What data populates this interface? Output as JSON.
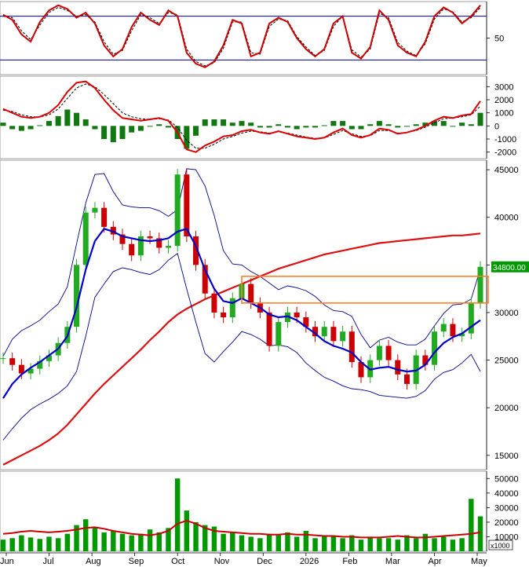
{
  "chart_data": [
    {
      "type": "line",
      "panel": "stochastic",
      "y_ticks": [
        50
      ],
      "ylim": [
        0,
        100
      ],
      "levels": [
        80,
        20
      ],
      "series": [
        {
          "values": [
            82,
            75,
            55,
            45,
            72,
            88,
            95,
            90,
            78,
            85,
            70,
            40,
            25,
            35,
            65,
            85,
            75,
            68,
            88,
            80,
            30,
            15,
            10,
            18,
            40,
            75,
            70,
            25,
            30,
            70,
            78,
            72,
            50,
            35,
            25,
            35,
            70,
            80,
            30,
            22,
            38,
            88,
            75,
            40,
            30,
            25,
            45,
            80,
            92,
            85,
            70,
            80,
            95
          ]
        },
        {
          "values": [
            80,
            78,
            60,
            48,
            68,
            85,
            92,
            88,
            80,
            82,
            72,
            45,
            28,
            33,
            60,
            82,
            78,
            70,
            85,
            82,
            35,
            18,
            12,
            16,
            36,
            72,
            72,
            30,
            28,
            66,
            76,
            74,
            52,
            38,
            26,
            33,
            66,
            80,
            34,
            24,
            35,
            84,
            78,
            44,
            32,
            26,
            42,
            76,
            90,
            86,
            72,
            78,
            92
          ]
        }
      ]
    },
    {
      "type": "line",
      "panel": "macd",
      "y_ticks": [
        3000,
        2000,
        1000,
        0,
        -1000,
        -2000
      ],
      "ylim": [
        -2500,
        3800
      ],
      "series": [
        {
          "values": [
            1300,
            1000,
            700,
            600,
            700,
            1000,
            1600,
            2600,
            3300,
            3400,
            2900,
            2000,
            1200,
            600,
            500,
            400,
            500,
            600,
            400,
            -500,
            -1800,
            -2000,
            -1500,
            -1200,
            -800,
            -700,
            -400,
            -300,
            -500,
            -600,
            -400,
            -600,
            -800,
            -900,
            -1000,
            -900,
            -500,
            -200,
            -700,
            -900,
            -700,
            -200,
            -300,
            -600,
            -500,
            -300,
            0,
            400,
            700,
            600,
            800,
            900,
            1900
          ]
        },
        {
          "values": [
            1200,
            1100,
            850,
            700,
            680,
            850,
            1300,
            2100,
            2900,
            3200,
            3000,
            2400,
            1700,
            1000,
            700,
            550,
            500,
            550,
            450,
            -100,
            -1100,
            -1700,
            -1700,
            -1400,
            -1000,
            -800,
            -550,
            -400,
            -450,
            -550,
            -450,
            -550,
            -700,
            -850,
            -950,
            -920,
            -650,
            -350,
            -600,
            -800,
            -750,
            -350,
            -350,
            -550,
            -500,
            -350,
            -100,
            250,
            550,
            600,
            700,
            850,
            1500
          ]
        }
      ]
    },
    {
      "type": "line",
      "panel": "price",
      "y_ticks": [
        45000,
        40000,
        35000,
        30000,
        25000,
        20000,
        15000
      ],
      "ylim": [
        13500,
        46000
      ],
      "x_ticks": [
        "Jun",
        "Jul",
        "Aug",
        "Sep",
        "Oct",
        "Nov",
        "Dec",
        "2026",
        "Feb",
        "Mar",
        "Apr",
        "May"
      ],
      "last_price_label": "34800.00",
      "series": [
        {
          "values": [
            25200,
            24500,
            23600,
            24100,
            24900,
            25500,
            26800,
            28500,
            35000,
            40500,
            41000,
            39000,
            38200,
            37200,
            36000,
            38000,
            37800,
            36800,
            37000,
            44500,
            38000,
            35000,
            32000,
            30000,
            29500,
            31500,
            33000,
            31000,
            30000,
            26500,
            29000,
            30000,
            29500,
            28500,
            27500,
            28500,
            27000,
            28000,
            24800,
            23200,
            25000,
            26500,
            25000,
            23500,
            22500,
            25500,
            24500,
            28000,
            28800,
            27500,
            27800,
            31000,
            34800
          ]
        },
        {
          "values": [
            21000,
            22500,
            23500,
            24200,
            24800,
            25500,
            26200,
            27500,
            30500,
            34500,
            37500,
            38800,
            38500,
            38000,
            37800,
            37600,
            37500,
            37600,
            37800,
            38500,
            38800,
            37000,
            34500,
            32500,
            31200,
            31000,
            31500,
            31000,
            30500,
            29800,
            29500,
            29600,
            29200,
            28500,
            27800,
            27000,
            26500,
            26200,
            25800,
            24800,
            24000,
            24200,
            24300,
            24000,
            23800,
            23900,
            24500,
            25800,
            26800,
            27400,
            27800,
            28500,
            29200
          ]
        },
        {
          "values": [
            16600,
            17800,
            18900,
            19800,
            20400,
            20900,
            21500,
            22300,
            23800,
            27500,
            31600,
            33000,
            34300,
            34700,
            34500,
            34200,
            34000,
            34500,
            35500,
            36200,
            32500,
            29000,
            25700,
            24800,
            25900,
            26900,
            28000,
            27700,
            27200,
            26500,
            26600,
            26400,
            25800,
            24700,
            23900,
            23200,
            22800,
            22300,
            22000,
            21900,
            21700,
            21300,
            21200,
            21100,
            21000,
            21200,
            21800,
            23000,
            23700,
            24000,
            24700,
            25600,
            23800
          ]
        },
        {
          "values": [
            25400,
            27200,
            28100,
            28600,
            29200,
            30100,
            30900,
            32700,
            37200,
            41500,
            44500,
            44600,
            42700,
            41300,
            41100,
            41000,
            41000,
            40700,
            40100,
            40800,
            45100,
            45000,
            43300,
            40200,
            36500,
            35100,
            35000,
            34300,
            33800,
            33100,
            32400,
            32800,
            32600,
            32300,
            31700,
            30800,
            30200,
            30100,
            29600,
            27700,
            26300,
            27100,
            27400,
            26900,
            26600,
            26600,
            27200,
            28600,
            29900,
            30800,
            30900,
            31400,
            34600
          ]
        },
        {
          "values": [
            14000,
            14500,
            15000,
            15500,
            16000,
            16600,
            17300,
            18200,
            19300,
            20400,
            21500,
            22500,
            23400,
            24300,
            25200,
            26100,
            27100,
            28000,
            29000,
            29800,
            30400,
            30900,
            31400,
            31800,
            32200,
            32600,
            33000,
            33400,
            33800,
            34200,
            34600,
            34900,
            35200,
            35500,
            35800,
            36100,
            36300,
            36500,
            36700,
            36900,
            37100,
            37300,
            37400,
            37500,
            37600,
            37700,
            37800,
            37900,
            38000,
            38100,
            38100,
            38200,
            38300
          ]
        }
      ],
      "annotations": [
        {
          "type": "rectangle",
          "color": "#ff7f27",
          "y_range": [
            31000,
            33800
          ]
        }
      ]
    },
    {
      "type": "bar",
      "panel": "volume",
      "y_ticks": [
        50000,
        40000,
        30000,
        20000,
        10000
      ],
      "unit_label": "x1000",
      "ylim": [
        0,
        55000
      ],
      "values": [
        8000,
        9000,
        11000,
        9500,
        8500,
        10000,
        9000,
        12000,
        18000,
        22000,
        16000,
        13000,
        14000,
        12000,
        11000,
        12000,
        15000,
        13000,
        16000,
        50000,
        28000,
        20000,
        18000,
        17000,
        12000,
        13000,
        11000,
        10000,
        9000,
        12000,
        11000,
        13000,
        10000,
        14000,
        9000,
        11000,
        10000,
        9000,
        11000,
        8000,
        10000,
        9000,
        9000,
        8000,
        11000,
        9000,
        12000,
        9000,
        10000,
        8000,
        9000,
        36000,
        24000
      ],
      "series": [
        {
          "values": [
            12000,
            12500,
            13500,
            14000,
            13500,
            13000,
            13500,
            14000,
            15000,
            16000,
            16500,
            15500,
            14000,
            13000,
            12000,
            11500,
            11000,
            12000,
            14000,
            19000,
            21000,
            19000,
            16000,
            14000,
            13500,
            13000,
            12500,
            12000,
            12000,
            11500,
            11500,
            12000,
            11500,
            11500,
            11000,
            10500,
            10500,
            10000,
            10000,
            9500,
            9500,
            9500,
            10000,
            10500,
            10000,
            9500,
            9500,
            10000,
            10500,
            11000,
            11500,
            12000,
            13000
          ]
        }
      ]
    }
  ],
  "colors": {
    "stoch_k": "#cc0000",
    "stoch_d": "#000000",
    "stoch_levels": "#00008b",
    "macd_line": "#dd0000",
    "macd_signal": "#000000",
    "macd_hist": "#117711",
    "candle_up": "#22aa22",
    "candle_down": "#cc0000",
    "ma_short": "#0000cc",
    "bollinger": "#000088",
    "ma_long": "#dd1111",
    "volume_bars": "#009900",
    "volume_ma": "#cc0000",
    "price_box": "#ff7f27",
    "price_label_bg": "#009900"
  }
}
